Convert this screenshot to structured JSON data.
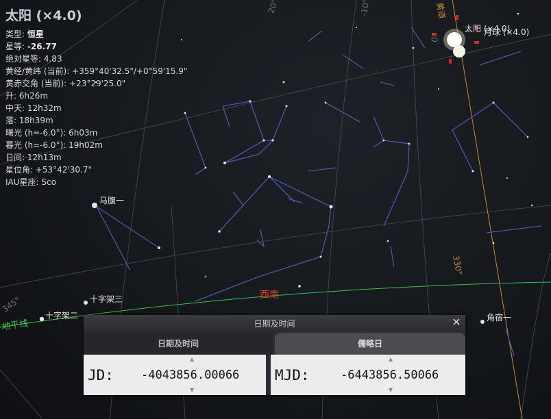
{
  "object": {
    "title": "太阳 (×4.0)",
    "info_rows": [
      {
        "key": "类型: ",
        "value": "恒星",
        "bold": true
      },
      {
        "key": "星等: ",
        "value": "-26.77",
        "bold": true
      },
      {
        "key": "绝对星等: ",
        "value": "4.83"
      },
      {
        "key": "黄经/黄纬 (当前): ",
        "value": "+359°40'32.5\"/+0°59'15.9\""
      },
      {
        "key": "黄赤交角 (当前): ",
        "value": "+23°29'25.0\""
      },
      {
        "key": "升: ",
        "value": "6h26m"
      },
      {
        "key": "中天: ",
        "value": "12h32m"
      },
      {
        "key": "落: ",
        "value": "18h39m"
      },
      {
        "key": "曙光 (h=-6.0°): ",
        "value": "6h03m"
      },
      {
        "key": "暮光 (h=-6.0°): ",
        "value": "19h02m"
      },
      {
        "key": "日间: ",
        "value": "12h13m"
      },
      {
        "key": "星位角: ",
        "value": "+53°42'30.7\""
      },
      {
        "key": "IAU星座: ",
        "value": "Sco"
      }
    ]
  },
  "sky": {
    "sun_label": "太阳 (×4.0)",
    "moon_label": "月球 (×4.0)",
    "ecliptic_label": "黄道",
    "star_labels": {
      "mafu": "马腹一",
      "crux3": "十字架三",
      "crux2": "十字架二",
      "spica": "角宿一"
    },
    "direction_southwest": "西南",
    "horizon_label": "地平线",
    "grid_labels": [
      "20°",
      "-10°",
      "0°",
      "345°",
      "330°"
    ]
  },
  "dialog": {
    "title": "日期及时间",
    "close_glyph": "✕",
    "tab_datetime": "日期及时间",
    "tab_julian": "儒略日",
    "jd_label": "JD:",
    "jd_value": "-4043856.00066",
    "mjd_label": "MJD:",
    "mjd_value": "-6443856.50066",
    "arrow_up": "▲",
    "arrow_down": "▼"
  },
  "colors": {
    "background": "#15181c",
    "constellation_line": "#4a5aa8",
    "grid_line": "#4a4d55",
    "horizon": "#3fbf4f",
    "ecliptic": "#c88a30",
    "direction": "#d23a2a"
  }
}
